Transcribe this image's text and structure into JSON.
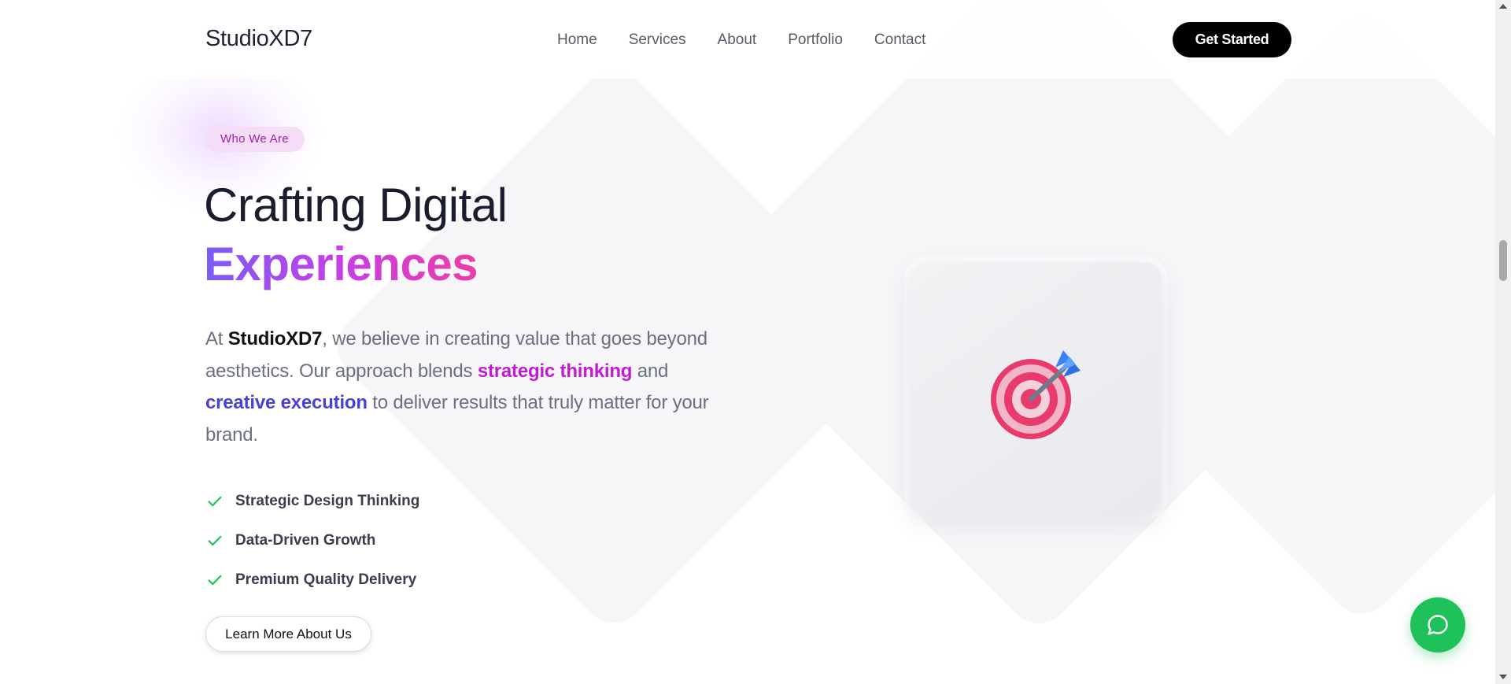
{
  "header": {
    "brand": "StudioXD7",
    "nav": [
      "Home",
      "Services",
      "About",
      "Portfolio",
      "Contact"
    ],
    "cta_label": "Get Started"
  },
  "hero": {
    "badge": "Who We Are",
    "title_line1": "Crafting Digital",
    "title_line2": "Experiences",
    "lead": {
      "p1": "At ",
      "brand": "StudioXD7",
      "p2": ", we believe in creating value that goes beyond aesthetics. Our approach blends ",
      "highlight1": "strategic thinking",
      "p3": " and ",
      "highlight2": "creative execution",
      "p4": " to deliver results that truly matter for your brand."
    },
    "features": [
      "Strategic Design Thinking",
      "Data-Driven Growth",
      "Premium Quality Delivery"
    ],
    "learn_more_label": "Learn More About Us"
  },
  "illustration": {
    "icon": "direct-hit-target-icon"
  },
  "chat": {
    "icon": "chat-bubble-icon"
  },
  "colors": {
    "accent_purple": "#c21bd0",
    "accent_indigo": "#4b3fd9",
    "check_green": "#22c55e",
    "chat_green": "#1fc15a",
    "cta_black": "#000000"
  }
}
